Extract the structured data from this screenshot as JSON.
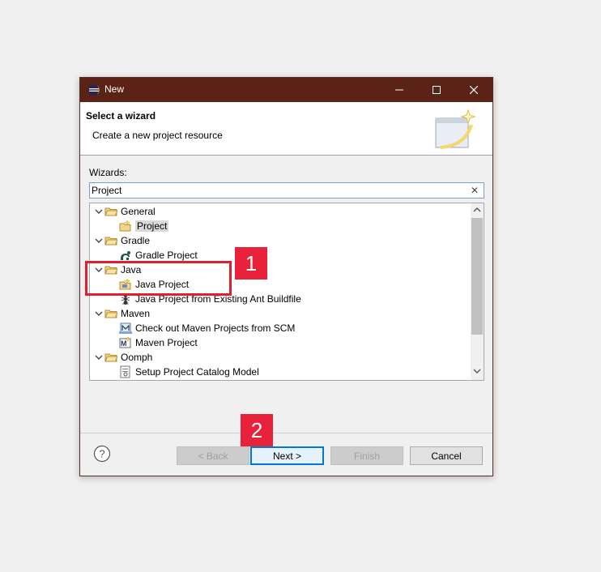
{
  "window": {
    "title": "New",
    "controls": {
      "minimize": "─",
      "maximize": "☐",
      "close": "✕"
    }
  },
  "banner": {
    "title": "Select a wizard",
    "description": "Create a new project resource"
  },
  "wizards": {
    "label": "Wizards:",
    "filter_value": "Project",
    "clear_glyph": "✕"
  },
  "tree": [
    {
      "type": "category",
      "label": "General",
      "expanded": true
    },
    {
      "type": "item",
      "label": "Project",
      "icon": "project-icon",
      "selected": true
    },
    {
      "type": "category",
      "label": "Gradle",
      "expanded": true
    },
    {
      "type": "item",
      "label": "Gradle Project",
      "icon": "gradle-icon"
    },
    {
      "type": "category",
      "label": "Java",
      "expanded": true
    },
    {
      "type": "item",
      "label": "Java Project",
      "icon": "java-project-icon"
    },
    {
      "type": "item",
      "label": "Java Project from Existing Ant Buildfile",
      "icon": "ant-icon"
    },
    {
      "type": "category",
      "label": "Maven",
      "expanded": true
    },
    {
      "type": "item",
      "label": "Check out Maven Projects from SCM",
      "icon": "maven-scm-icon"
    },
    {
      "type": "item",
      "label": "Maven Project",
      "icon": "maven-project-icon"
    },
    {
      "type": "category",
      "label": "Oomph",
      "expanded": true
    },
    {
      "type": "item",
      "label": "Setup Project Catalog Model",
      "icon": "setup-model-icon"
    }
  ],
  "buttons": {
    "help": "?",
    "back": "< Back",
    "next": "Next >",
    "finish": "Finish",
    "cancel": "Cancel"
  },
  "annotations": {
    "callout_1": "1",
    "callout_2": "2",
    "color": "#e8223a"
  },
  "colors": {
    "titlebar": "#5b2216",
    "focus": "#0078d7"
  }
}
